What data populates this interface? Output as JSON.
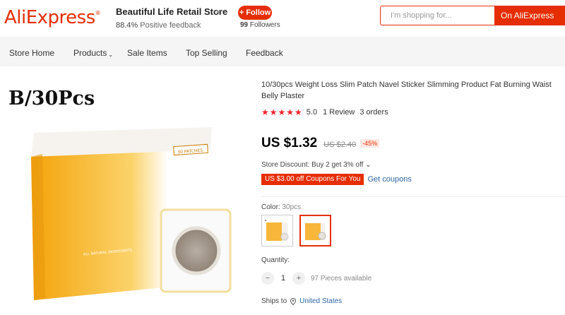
{
  "header": {
    "logo_text": "AliExpress",
    "store_name": "Beautiful Life Retail Store",
    "feedback_percent": "88.4%",
    "feedback_label": "Positive feedback",
    "follow_label": "+ Follow",
    "followers_count": "99",
    "followers_label": "Followers",
    "search_placeholder": "I'm shopping for...",
    "search_button": "On AliExpress"
  },
  "nav": {
    "items": [
      "Store Home",
      "Products",
      "Sale Items",
      "Top Selling",
      "Feedback"
    ]
  },
  "product": {
    "image_label": "B/30Pcs",
    "box_label": "30 PATCHES",
    "box_side_text": "ALL NATURAL INGREDIENTS",
    "title": "10/30pcs Weight Loss Slim Patch Navel Sticker Slimming Product Fat Burning Waist Belly Plaster",
    "rating": "5.0",
    "reviews": "1 Review",
    "orders": "3 orders",
    "price": "US $1.32",
    "old_price": "US $2.40",
    "discount": "-45%",
    "store_discount": "Store Discount: Buy 2 get 3% off",
    "coupon": "US $3.00 off Coupons For You",
    "get_coupons": "Get coupons",
    "color_label": "Color:",
    "color_value": "30pcs",
    "quantity_label": "Quantity:",
    "quantity_value": "1",
    "minus": "−",
    "plus": "+",
    "available": "97 Pieces available",
    "ships_to_label": "Ships to",
    "ships_to_country": "United States"
  },
  "colors": {
    "accent": "#e62e04",
    "link": "#2e67a6",
    "star": "#f5222d"
  }
}
